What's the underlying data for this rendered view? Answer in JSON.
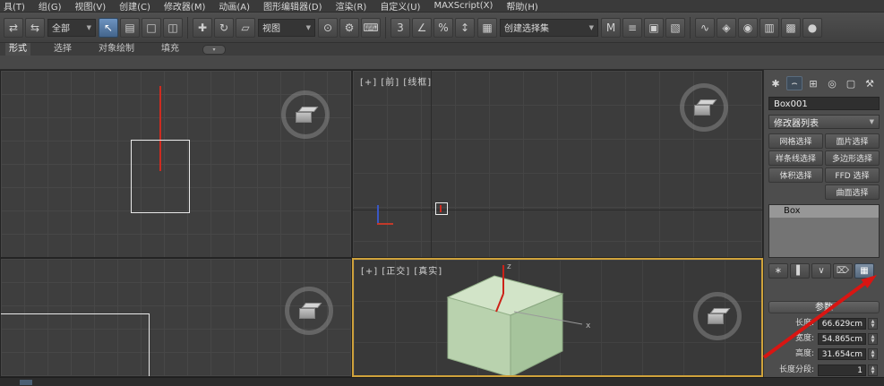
{
  "menu_bar": {
    "items": [
      "具(T)",
      "组(G)",
      "视图(V)",
      "创建(C)",
      "修改器(M)",
      "动画(A)",
      "图形编辑器(D)",
      "渲染(R)",
      "自定义(U)",
      "MAXScript(X)",
      "帮助(H)"
    ]
  },
  "toolbar": {
    "filter_dropdown_value": "全部",
    "coord_dropdown_value": "视图",
    "named_sets_value": "创建选择集",
    "dropdown_arrow": "▼",
    "groups": {
      "link": [
        {
          "name": "select-and-link-icon",
          "glyph": "⇄"
        },
        {
          "name": "unlink-selection-icon",
          "glyph": "⇆"
        }
      ],
      "selection": [
        {
          "name": "select-object-icon",
          "glyph": "↖",
          "active": true
        },
        {
          "name": "select-by-name-icon",
          "glyph": "▤"
        },
        {
          "name": "selection-region-icon",
          "glyph": "□"
        },
        {
          "name": "window-crossing-icon",
          "glyph": "◫"
        }
      ],
      "transform": [
        {
          "name": "select-and-move-icon",
          "glyph": "✚"
        },
        {
          "name": "select-and-rotate-icon",
          "glyph": "↻"
        },
        {
          "name": "select-and-scale-icon",
          "glyph": "▱"
        }
      ],
      "pivot": [
        {
          "name": "use-pivot-point-icon",
          "glyph": "⊙"
        },
        {
          "name": "select-and-manipulate-icon",
          "glyph": "⚙"
        },
        {
          "name": "keyboard-override-icon",
          "glyph": "⌨"
        }
      ],
      "snaps": [
        {
          "name": "snap-toggle-icon",
          "glyph": "3"
        },
        {
          "name": "angle-snap-icon",
          "glyph": "∠"
        },
        {
          "name": "percent-snap-icon",
          "glyph": "%"
        },
        {
          "name": "spinner-snap-icon",
          "glyph": "↕"
        }
      ],
      "sets": [
        {
          "name": "edit-named-sets-icon",
          "glyph": "▦"
        }
      ],
      "tools": [
        {
          "name": "mirror-icon",
          "glyph": "M"
        },
        {
          "name": "align-icon",
          "glyph": "≡"
        },
        {
          "name": "layer-manager-icon",
          "glyph": "▣"
        },
        {
          "name": "graphite-ribbon-icon",
          "glyph": "▧"
        }
      ],
      "editors": [
        {
          "name": "curve-editor-icon",
          "glyph": "∿"
        },
        {
          "name": "schematic-view-icon",
          "glyph": "◈"
        },
        {
          "name": "material-editor-icon",
          "glyph": "◉"
        },
        {
          "name": "render-setup-icon",
          "glyph": "▥"
        },
        {
          "name": "rendered-frame-icon",
          "glyph": "▩"
        },
        {
          "name": "render-production-icon",
          "glyph": "●"
        }
      ]
    }
  },
  "ribbon": {
    "tabs": [
      "形式",
      "选择",
      "对象绘制",
      "填充"
    ],
    "pill_glyph": "▾"
  },
  "viewports": {
    "front": {
      "label": "[+] [前] [线框]"
    },
    "ortho": {
      "label": "[+] [正交] [真实]"
    },
    "ortho_axis_x": "x",
    "ortho_axis_z": "z"
  },
  "command_panel": {
    "tabs": [
      {
        "name": "create-tab-icon",
        "glyph": "✱"
      },
      {
        "name": "modify-tab-icon",
        "glyph": "⌢",
        "active": true
      },
      {
        "name": "hierarchy-tab-icon",
        "glyph": "⊞"
      },
      {
        "name": "motion-tab-icon",
        "glyph": "◎"
      },
      {
        "name": "display-tab-icon",
        "glyph": "▢"
      },
      {
        "name": "utilities-tab-icon",
        "glyph": "⚒"
      }
    ],
    "object_name": "Box001",
    "modifier_list_label": "修改器列表",
    "modifier_buttons": {
      "r0c0": "网格选择",
      "r0c1": "面片选择",
      "r1c0": "样条线选择",
      "r1c1": "多边形选择",
      "r2c0": "体积选择",
      "r2c1": "FFD 选择",
      "r3c1": "曲面选择"
    },
    "stack_item": "Box",
    "stack_toolbar": [
      {
        "name": "pin-stack-icon",
        "glyph": "∗"
      },
      {
        "name": "show-end-result-icon",
        "glyph": "▌"
      },
      {
        "name": "make-unique-icon",
        "glyph": "∨"
      },
      {
        "name": "remove-modifier-icon",
        "glyph": "⌦"
      },
      {
        "name": "configure-modifier-sets-icon",
        "glyph": "▦",
        "active": true
      }
    ],
    "rollout_title": "参数",
    "params": {
      "length_label": "长度:",
      "length_value": "66.629cm",
      "width_label": "宽度:",
      "width_value": "54.865cm",
      "height_label": "高度:",
      "height_value": "31.654cm",
      "length_segs_label": "长度分段:",
      "length_segs_value": "1"
    }
  },
  "colors": {
    "annotation_red": "#d91512",
    "active_viewport_border": "#cfa23b",
    "box_top": "#d2e4c8",
    "box_left": "#b9d2ae",
    "box_right": "#a6c49c"
  }
}
